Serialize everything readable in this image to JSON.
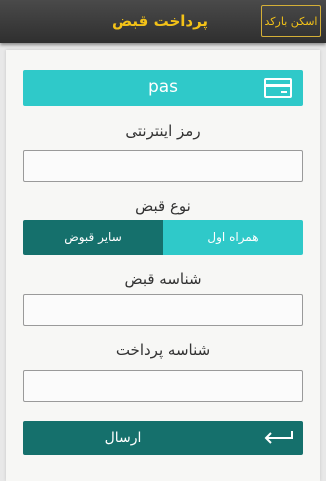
{
  "header": {
    "title": "پرداخت قبض",
    "scan_button": "اسکن بارکد"
  },
  "form": {
    "banner_text": "pas",
    "password_label": "رمز اینترنتی",
    "bill_type_label": "نوع قبض",
    "bill_types": [
      "همراه اول",
      "سایر قبوض"
    ],
    "bill_id_label": "شناسه قبض",
    "payment_id_label": "شناسه پرداخت",
    "submit_label": "ارسال"
  },
  "icons": {
    "banner_icon": "credit-card-icon",
    "submit_icon": "enter-arrow-icon"
  },
  "colors": {
    "header_text": "#f3c218",
    "accent": "#2fc9c9",
    "dark_accent": "#15706c"
  }
}
